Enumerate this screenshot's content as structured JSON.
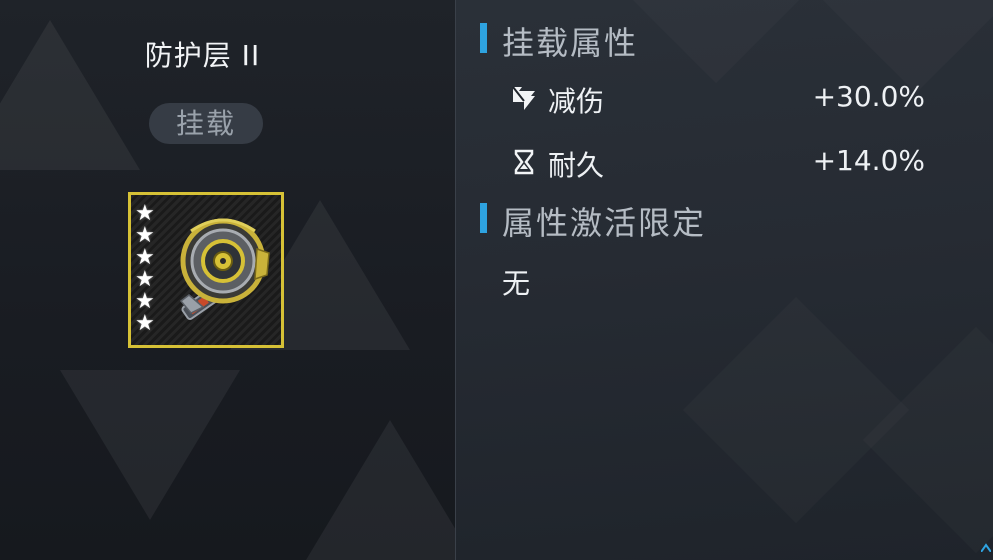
{
  "item": {
    "name": "防护层 II",
    "badge": "挂载",
    "stars": 6,
    "rarity_color": "#d6c136",
    "icon": "shield-module-icon"
  },
  "equip_attributes": {
    "title": "挂载属性",
    "stats": [
      {
        "icon": "damage-reduction-icon",
        "label": "减伤",
        "value": "+30.0%"
      },
      {
        "icon": "hourglass-icon",
        "label": "耐久",
        "value": "+14.0%"
      }
    ]
  },
  "activation_limit": {
    "title": "属性激活限定",
    "value": "无"
  },
  "colors": {
    "accent_bar": "#2ea3e0",
    "left_bg": "#1c2027",
    "right_bg": "#2a3038"
  }
}
